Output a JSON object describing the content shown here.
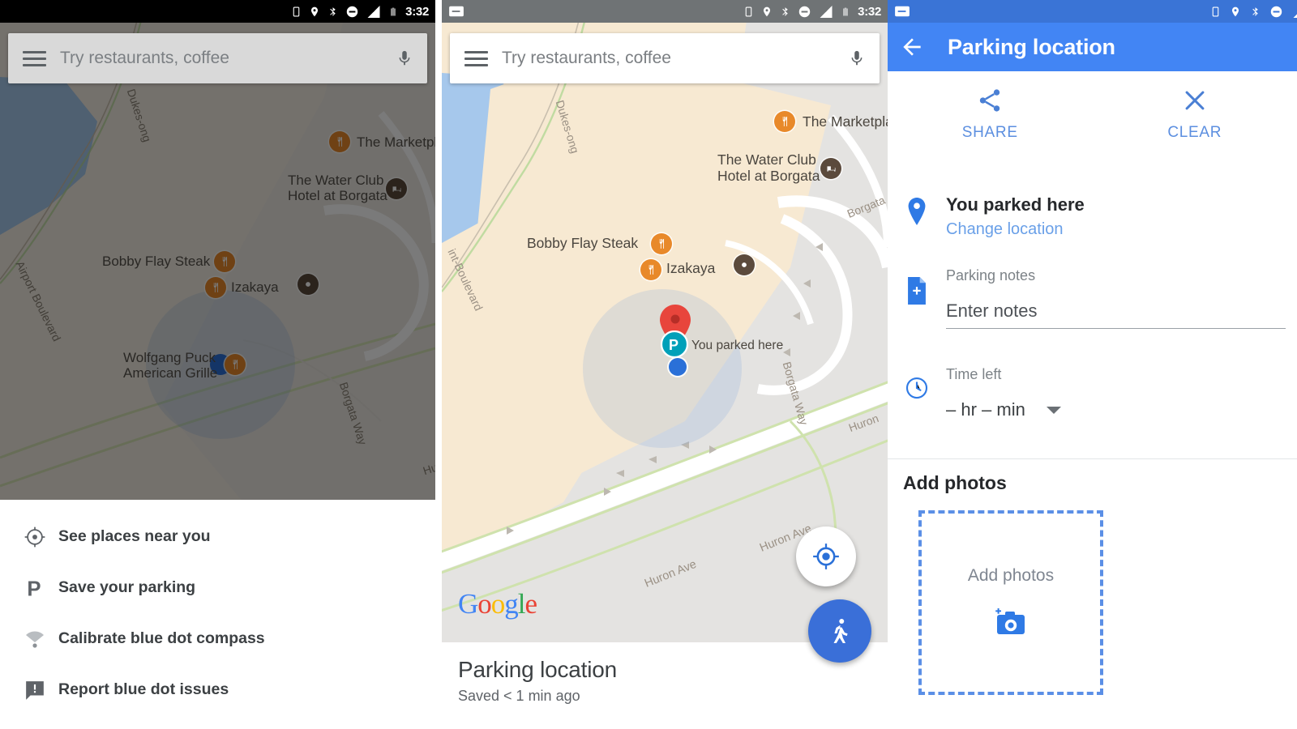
{
  "statusbar": {
    "time": "3:32",
    "icons": [
      "vibrate-icon",
      "location-icon",
      "bluetooth-icon",
      "do-not-disturb-icon",
      "signal-icon",
      "battery-icon"
    ],
    "notification_icon": "screenshot-notification-icon"
  },
  "panel1": {
    "search": {
      "placeholder": "Try restaurants, coffee",
      "menu_icon": "hamburger-menu-icon",
      "mic_icon": "microphone-icon"
    },
    "menu_items": [
      {
        "icon": "crosshair-icon",
        "label": "See places near you"
      },
      {
        "icon": "parking-p-icon",
        "label": "Save your parking"
      },
      {
        "icon": "compass-wave-icon",
        "label": "Calibrate blue dot compass"
      },
      {
        "icon": "report-flag-icon",
        "label": "Report blue dot issues"
      }
    ],
    "map_labels": [
      {
        "text": "The Marketplace",
        "icon": "restaurant-icon"
      },
      {
        "text": "The Water Club",
        "text2": "Hotel at Borgata",
        "icon": "hotel-icon"
      },
      {
        "text": "Bobby Flay Steak",
        "icon": "restaurant-icon"
      },
      {
        "text": "Izakaya",
        "icon": "restaurant-icon"
      },
      {
        "text": "Wolfgang Puck",
        "text2": "American Grille",
        "icon": "restaurant-icon"
      }
    ],
    "street_labels": [
      "Dukes-ong",
      "Borgata Way",
      "Airport Boulevard",
      "Huron"
    ]
  },
  "panel2": {
    "search": {
      "placeholder": "Try restaurants, coffee",
      "menu_icon": "hamburger-menu-icon",
      "mic_icon": "microphone-icon"
    },
    "map_labels": [
      {
        "text": "The Marketplace",
        "icon": "restaurant-icon"
      },
      {
        "text": "The Water Club",
        "text2": "Hotel at Borgata",
        "icon": "hotel-icon"
      },
      {
        "text": "Bobby Flay Steak",
        "icon": "restaurant-icon"
      },
      {
        "text": "Izakaya",
        "icon": "restaurant-icon"
      }
    ],
    "parked_callout": "You parked here",
    "street_labels": [
      "Dukes-ong",
      "int-Boulevard",
      "Borgata Way",
      "Borgata",
      "Huron",
      "Huron Ave",
      "Huron Ave"
    ],
    "google_wordmark": "Google",
    "fab_locate_icon": "my-location-icon",
    "fab_walk_icon": "walking-person-icon",
    "card": {
      "title": "Parking location",
      "subtitle": "Saved < 1 min ago"
    }
  },
  "panel3": {
    "appbar": {
      "back_icon": "back-arrow-icon",
      "title": "Parking location"
    },
    "actions": [
      {
        "icon": "share-icon",
        "label": "SHARE"
      },
      {
        "icon": "close-x-icon",
        "label": "CLEAR"
      }
    ],
    "parked": {
      "icon": "map-pin-icon",
      "title": "You parked here",
      "link": "Change location"
    },
    "notes": {
      "icon": "note-add-icon",
      "caption": "Parking notes",
      "placeholder": "Enter notes",
      "value": ""
    },
    "time_left": {
      "icon": "clock-icon",
      "caption": "Time left",
      "value": "– hr – min",
      "caret_icon": "chevron-down-icon"
    },
    "photos": {
      "section_title": "Add photos",
      "dropzone_label": "Add photos",
      "dropzone_icon": "add-photo-camera-icon"
    }
  },
  "colors": {
    "brand_blue": "#4285f4",
    "appbar_blue": "#4285f4",
    "link_blue": "#6aa0e8",
    "poi_orange": "#e8892a",
    "pin_red": "#e8453c",
    "status_dark": "#000000"
  }
}
